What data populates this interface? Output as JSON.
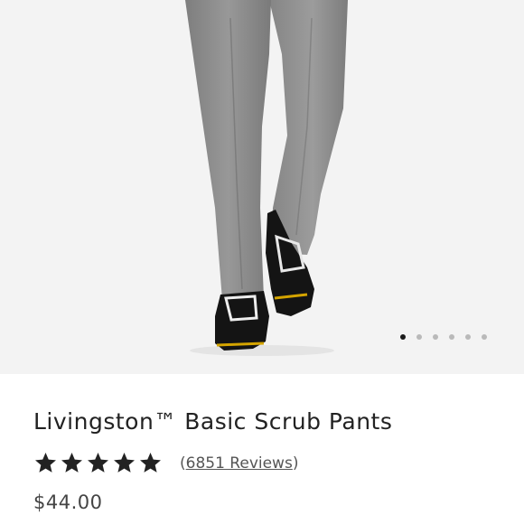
{
  "product": {
    "title": "Livingston™ Basic Scrub Pants",
    "rating": 5,
    "reviews_open": "(",
    "reviews_count": "6851 Reviews",
    "reviews_close": ")",
    "price": "$44.00"
  },
  "gallery": {
    "slide_count": 6,
    "active_index": 0
  },
  "colors": {
    "pants": "#8a8a8a",
    "background": "#f3f3f3",
    "dot_active": "#1a1a1a",
    "dot_inactive": "#b9b9b9"
  }
}
